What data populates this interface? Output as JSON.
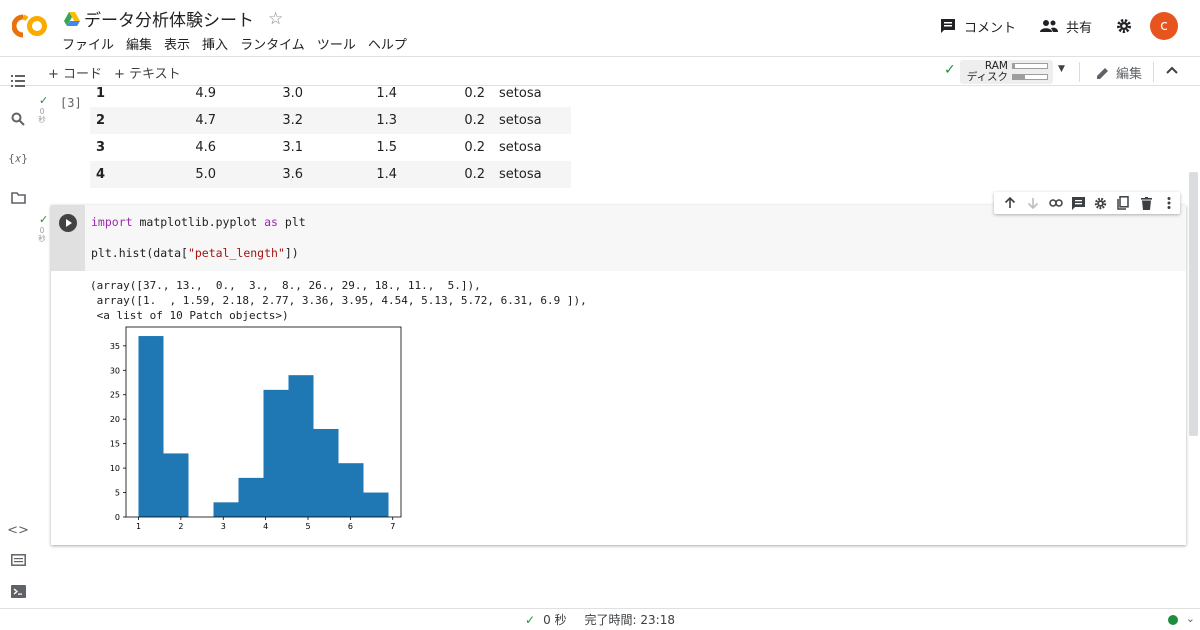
{
  "header": {
    "doc_title": "データ分析体験シート",
    "menu": [
      "ファイル",
      "編集",
      "表示",
      "挿入",
      "ランタイム",
      "ツール",
      "ヘルプ"
    ],
    "comment_label": "コメント",
    "share_label": "共有",
    "avatar_letter": "c"
  },
  "toolbar": {
    "add_code": "+ コード",
    "add_text": "+ テキスト",
    "ram_label": "RAM",
    "disk_label": "ディスク",
    "ram_usage": 0.05,
    "disk_usage": 0.35,
    "edit_label": "編集"
  },
  "prev_cell": {
    "exec_count": "[3]",
    "exec_time": "0\n秒",
    "rows": [
      {
        "idx": "1",
        "c1": "4.9",
        "c2": "3.0",
        "c3": "1.4",
        "c4": "0.2",
        "species": "setosa"
      },
      {
        "idx": "2",
        "c1": "4.7",
        "c2": "3.2",
        "c3": "1.3",
        "c4": "0.2",
        "species": "setosa"
      },
      {
        "idx": "3",
        "c1": "4.6",
        "c2": "3.1",
        "c3": "1.5",
        "c4": "0.2",
        "species": "setosa"
      },
      {
        "idx": "4",
        "c1": "5.0",
        "c2": "3.6",
        "c3": "1.4",
        "c4": "0.2",
        "species": "setosa"
      }
    ]
  },
  "code_cell": {
    "exec_time": "0\n秒",
    "line1_kw1": "import",
    "line1_mid": " matplotlib.pyplot ",
    "line1_kw2": "as",
    "line1_end": " plt",
    "line2_a": "plt.hist(data[",
    "line2_str": "\"petal_length\"",
    "line2_b": "])",
    "output": [
      "(array([37., 13.,  0.,  3.,  8., 26., 29., 18., 11.,  5.]),",
      " array([1.  , 1.59, 2.18, 2.77, 3.36, 3.95, 4.54, 5.13, 5.72, 6.31, 6.9 ]),",
      " <a list of 10 Patch objects>)"
    ]
  },
  "chart_data": {
    "type": "bar",
    "bin_edges": [
      1.0,
      1.59,
      2.18,
      2.77,
      3.36,
      3.95,
      4.54,
      5.13,
      5.72,
      6.31,
      6.9
    ],
    "values": [
      37,
      13,
      0,
      3,
      8,
      26,
      29,
      18,
      11,
      5
    ],
    "xlim": [
      0.705,
      7.195
    ],
    "ylim": [
      0,
      38.85
    ],
    "xticks": [
      "1",
      "2",
      "3",
      "4",
      "5",
      "6",
      "7"
    ],
    "yticks": [
      "0",
      "5",
      "10",
      "15",
      "20",
      "25",
      "30",
      "35"
    ],
    "color": "#1f77b4",
    "title": "",
    "xlabel": "",
    "ylabel": ""
  },
  "status": {
    "elapsed": "0 秒",
    "completed": "完了時間: 23:18"
  },
  "colors": {
    "accent": "#1e8e3e",
    "avatar": "#e8541e",
    "logo_orange": "#f9ab00"
  }
}
